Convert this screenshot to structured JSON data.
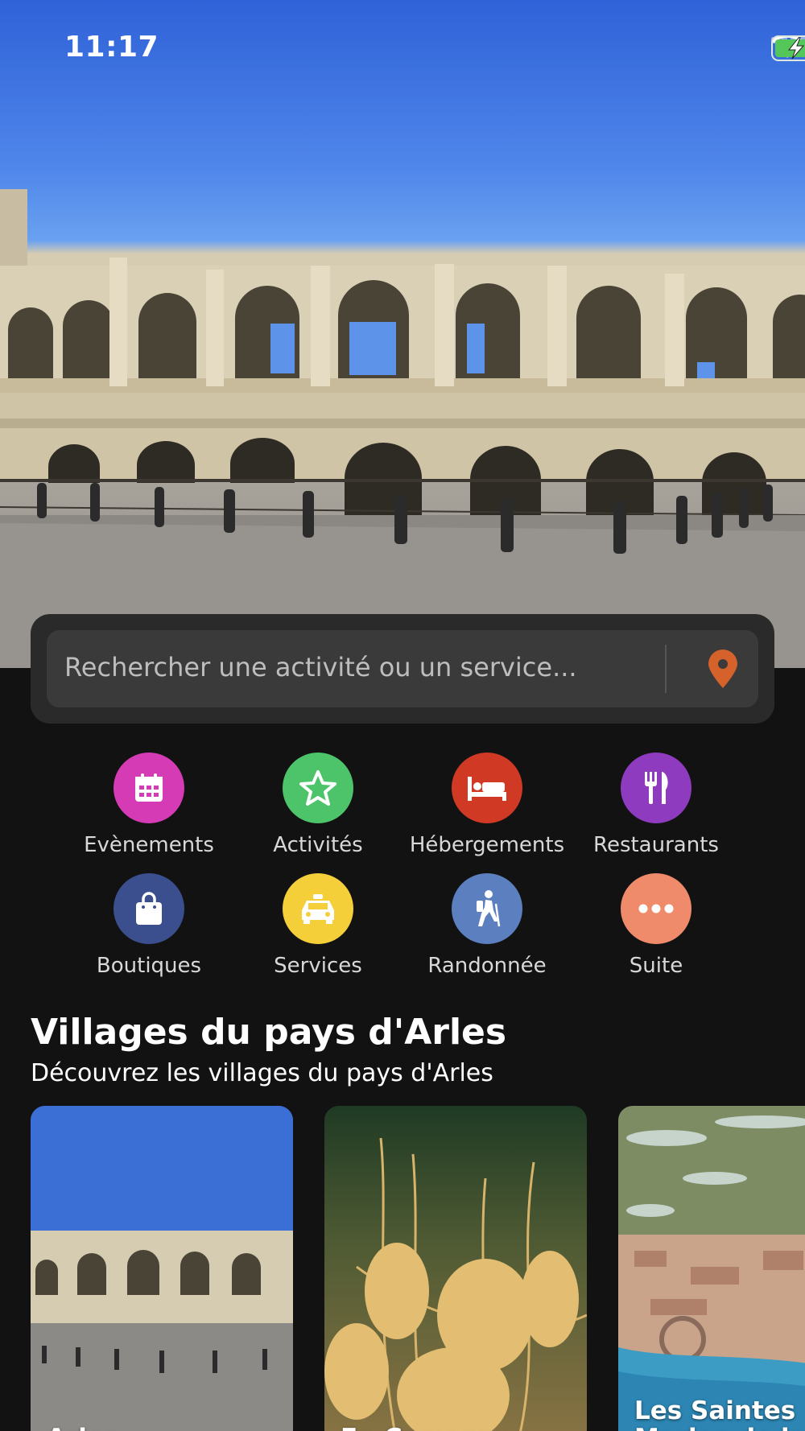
{
  "status_bar": {
    "time": "11:17"
  },
  "search": {
    "placeholder": "Rechercher une activité ou un service...",
    "location_icon": "location-pin-icon",
    "pin_color": "#d4622a"
  },
  "categories": [
    {
      "label": "Evènements",
      "icon": "calendar-icon",
      "color": "#d63bb6"
    },
    {
      "label": "Activités",
      "icon": "star-icon",
      "color": "#4dc36a"
    },
    {
      "label": "Hébergements",
      "icon": "bed-icon",
      "color": "#d03a24"
    },
    {
      "label": "Restaurants",
      "icon": "fork-knife-icon",
      "color": "#8e3bbf"
    },
    {
      "label": "Boutiques",
      "icon": "shopping-bag-icon",
      "color": "#3b4f8f"
    },
    {
      "label": "Services",
      "icon": "taxi-icon",
      "color": "#f4cf3a"
    },
    {
      "label": "Randonnée",
      "icon": "hiker-icon",
      "color": "#5b7fbf"
    },
    {
      "label": "Suite",
      "icon": "more-dots-icon",
      "color": "#ef8a6a"
    }
  ],
  "section": {
    "title": "Villages du pays d'Arles",
    "subtitle": "Découvrez les villages du pays d'Arles"
  },
  "villages": [
    {
      "name": "Arles"
    },
    {
      "name": "En Camargue"
    },
    {
      "name": "Les Saintes Maries de la Mer"
    }
  ]
}
